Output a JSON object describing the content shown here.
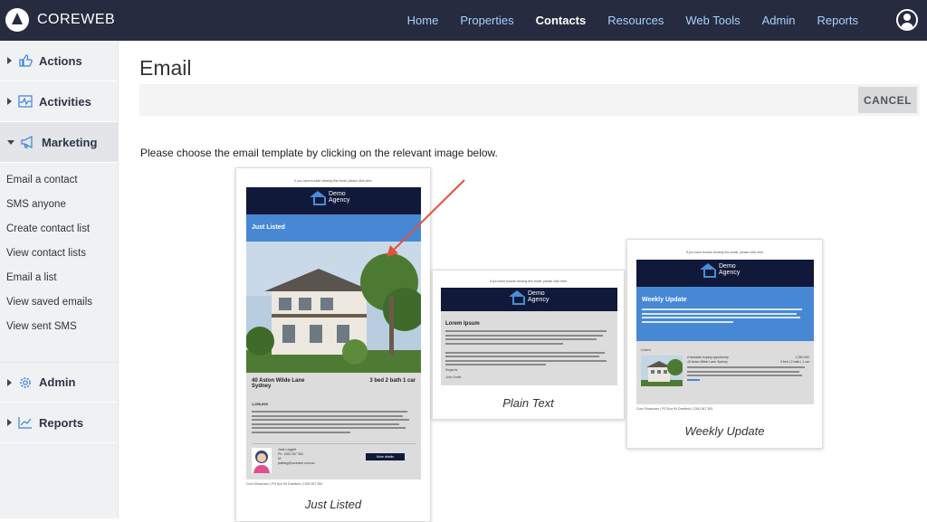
{
  "app": {
    "brand": "COREWEB"
  },
  "nav": {
    "items": [
      {
        "label": "Home",
        "active": false
      },
      {
        "label": "Properties",
        "active": false
      },
      {
        "label": "Contacts",
        "active": true
      },
      {
        "label": "Resources",
        "active": false
      },
      {
        "label": "Web Tools",
        "active": false
      },
      {
        "label": "Admin",
        "active": false
      },
      {
        "label": "Reports",
        "active": false
      }
    ],
    "user_icon": "user-circle-icon"
  },
  "sidebar": {
    "sections": [
      {
        "label": "Actions",
        "icon": "thumbs-up-icon",
        "open": false
      },
      {
        "label": "Activities",
        "icon": "activity-chart-icon",
        "open": false
      },
      {
        "label": "Marketing",
        "icon": "megaphone-icon",
        "open": true
      },
      {
        "label": "Admin",
        "icon": "gear-icon",
        "open": false
      },
      {
        "label": "Reports",
        "icon": "trend-chart-icon",
        "open": false
      }
    ],
    "marketing_items": [
      "Email a contact",
      "SMS anyone",
      "Create contact list",
      "View contact lists",
      "Email a list",
      "View saved emails",
      "View sent SMS"
    ]
  },
  "main": {
    "title": "Email",
    "cancel_label": "CANCEL",
    "instruction": "Please choose the email template by clicking on the relevant image below."
  },
  "templates": [
    {
      "caption": "Just Listed",
      "top_note": "If you have trouble viewing this email, please click here",
      "logo_line1": "Demo",
      "logo_line2": "Agency",
      "banner": "Just Listed",
      "address": "40 Aston Wilde Lane Sydney",
      "features": "3 bed 2 bath 1 car",
      "price": "1,200,000",
      "agent_name": "Jade Leggett",
      "agent_phone": "Ph: 1300 267 353",
      "agent_m": "M:",
      "agent_email": "jadeleg@coreweb.com.au",
      "button": "More details",
      "footer": "Core Showroom | PO Box 99 Dumfield | 1300 267 353"
    },
    {
      "caption": "Plain Text",
      "top_note": "If you have trouble viewing this email, please click here",
      "logo_line1": "Demo",
      "logo_line2": "Agency",
      "heading": "Lorem Ipsum",
      "regards": "Regards,",
      "signoff": "John Smith"
    },
    {
      "caption": "Weekly Update",
      "top_note": "If you have trouble viewing this email, please click here",
      "logo_line1": "Demo",
      "logo_line2": "Agency",
      "banner": "Weekly Update",
      "listed_label": "Listed",
      "listing_title": "A fantastic buying opportunity",
      "listing_price": "1,250,000",
      "listing_address": "40 Aston Wilde Lane Sydney",
      "listing_features": "3 bed | 2 bath | 1 car",
      "footer": "Core Showroom | PO Box 99 Dumfield | 1300 267 353"
    }
  ],
  "colors": {
    "topbar": "#262b3f",
    "nav_link": "#a8d0ff",
    "email_header": "#101939",
    "email_blue": "#4788d4",
    "annotation_arrow": "#e0533b"
  }
}
